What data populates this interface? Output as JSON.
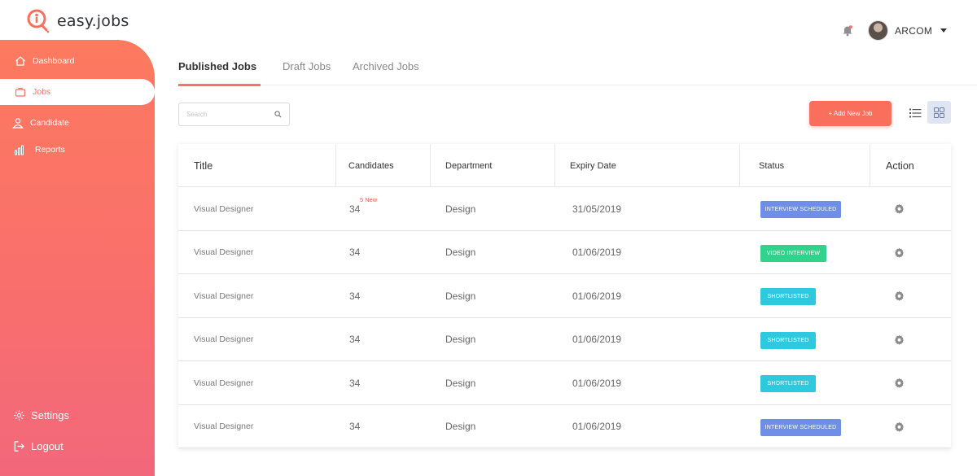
{
  "brand": {
    "name": "easy.jobs",
    "accent": "#fa7363"
  },
  "sidebar": {
    "items": [
      {
        "label": "Dashboard",
        "icon": "home-icon",
        "active": false
      },
      {
        "label": "Jobs",
        "icon": "briefcase-icon",
        "active": true
      },
      {
        "label": "Candidate",
        "icon": "user-icon",
        "active": false
      },
      {
        "label": "Reports",
        "icon": "bar-chart-icon",
        "active": false
      }
    ],
    "bottom": [
      {
        "label": "Settings",
        "icon": "gear-icon"
      },
      {
        "label": "Logout",
        "icon": "logout-icon"
      }
    ]
  },
  "header": {
    "user_name": "ARCOM",
    "notification_icon": "bell-icon"
  },
  "tabs": [
    {
      "label": "Published Jobs",
      "active": true
    },
    {
      "label": "Draft Jobs",
      "active": false
    },
    {
      "label": "Archived Jobs",
      "active": false
    }
  ],
  "toolbar": {
    "search_placeholder": "Search",
    "add_button_label": "+ Add New Job",
    "view_options": [
      "list-view-icon",
      "grid-view-icon"
    ],
    "active_view": "grid-view-icon"
  },
  "table": {
    "columns": [
      "Title",
      "Candidates",
      "Department",
      "Expiry Date",
      "Status",
      "Action"
    ],
    "rows": [
      {
        "title": "Visual Designer",
        "candidates": "34",
        "new_label": "5 New",
        "department": "Design",
        "expiry": "31/05/2019",
        "status": "INTERVIEW SCHEDULED",
        "status_color": "#6f8ee8"
      },
      {
        "title": "Visual Designer",
        "candidates": "34",
        "new_label": "",
        "department": "Design",
        "expiry": "01/06/2019",
        "status": "VIDEO INTERVIEW",
        "status_color": "#2fd38b"
      },
      {
        "title": "Visual Designer",
        "candidates": "34",
        "new_label": "",
        "department": "Design",
        "expiry": "01/06/2019",
        "status": "SHORTLISTED",
        "status_color": "#2fc9df"
      },
      {
        "title": "Visual Designer",
        "candidates": "34",
        "new_label": "",
        "department": "Design",
        "expiry": "01/06/2019",
        "status": "SHORTLISTED",
        "status_color": "#2fc9df"
      },
      {
        "title": "Visual Designer",
        "candidates": "34",
        "new_label": "",
        "department": "Design",
        "expiry": "01/06/2019",
        "status": "SHORTLISTED",
        "status_color": "#2fc9df"
      },
      {
        "title": "Visual Designer",
        "candidates": "34",
        "new_label": "",
        "department": "Design",
        "expiry": "01/06/2019",
        "status": "INTERVIEW SCHEDULED",
        "status_color": "#6f8ee8"
      }
    ]
  }
}
